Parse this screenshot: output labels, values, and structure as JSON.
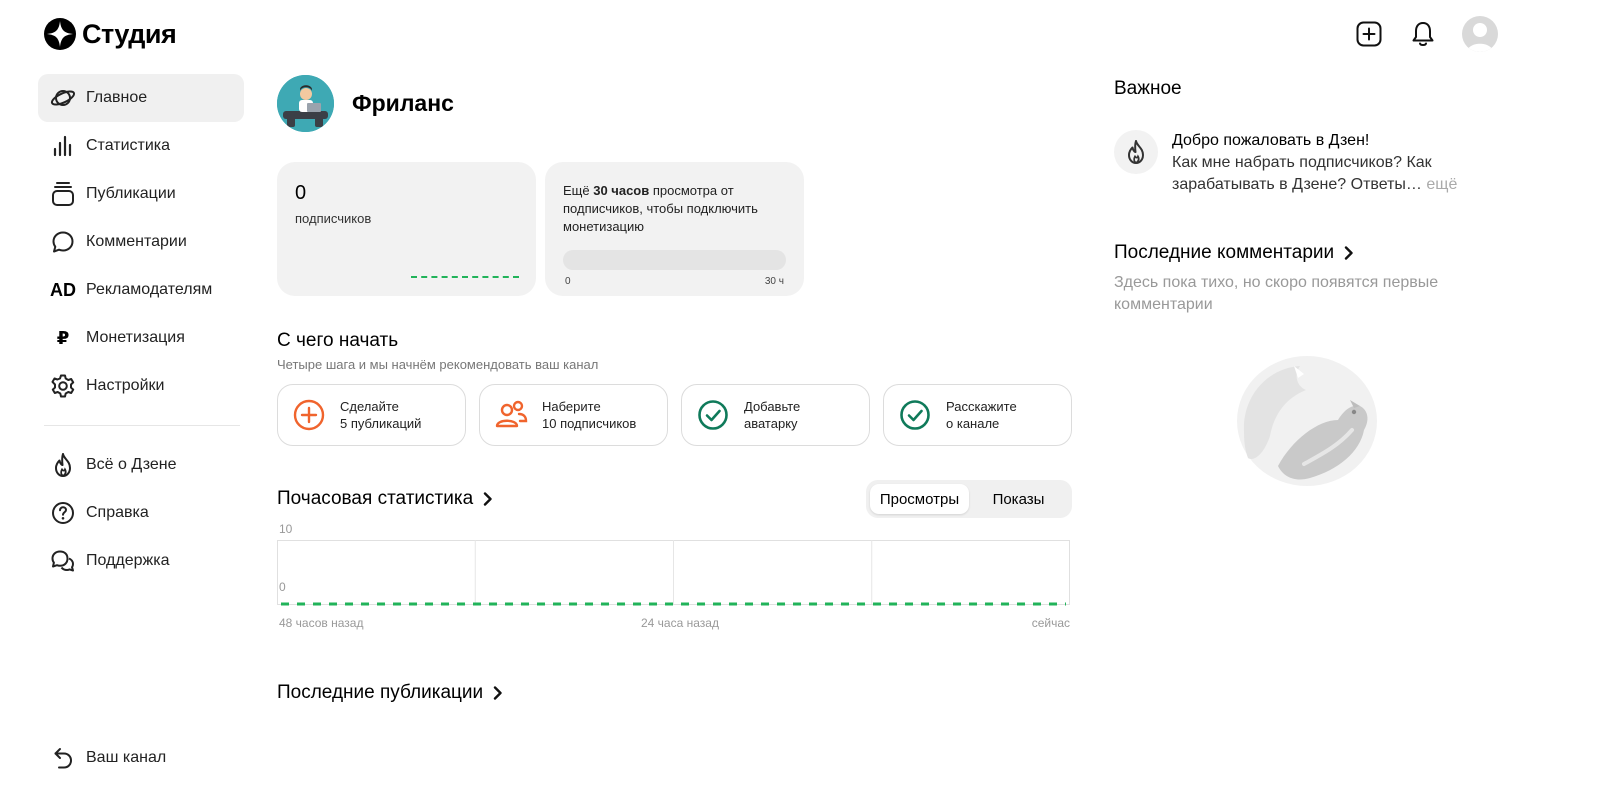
{
  "app": {
    "logo_text": "Студия"
  },
  "top_actions": {
    "create_icon": "plus-square-icon",
    "bell_icon": "bell-icon",
    "avatar_icon": "user-avatar"
  },
  "sidebar": {
    "items": [
      {
        "label": "Главное",
        "icon": "planet-icon",
        "active": true
      },
      {
        "label": "Статистика",
        "icon": "bar-chart-icon"
      },
      {
        "label": "Публикации",
        "icon": "stack-icon"
      },
      {
        "label": "Комментарии",
        "icon": "speech-bubble-icon"
      },
      {
        "label": "Рекламодателям",
        "icon": "ad-icon",
        "icon_text": "AD"
      },
      {
        "label": "Монетизация",
        "icon": "ruble-icon",
        "icon_text": "₽"
      },
      {
        "label": "Настройки",
        "icon": "gear-icon"
      }
    ],
    "secondary": [
      {
        "label": "Всё о Дзене",
        "icon": "flame-icon"
      },
      {
        "label": "Справка",
        "icon": "question-icon"
      },
      {
        "label": "Поддержка",
        "icon": "chat-bubbles-icon"
      }
    ],
    "bottom": {
      "label": "Ваш канал",
      "icon": "back-arrow-icon"
    }
  },
  "channel": {
    "name": "Фриланс"
  },
  "subscribers_card": {
    "value": "0",
    "label": "подписчиков"
  },
  "monetization_card": {
    "text_prefix": "Ещё ",
    "text_bold": "30 часов",
    "text_suffix": " просмотра от подписчиков, чтобы подключить монетизацию",
    "progress": 0,
    "min_label": "0",
    "max_label": "30 ч"
  },
  "getting_started": {
    "title": "С чего начать",
    "subtitle": "Четыре шага и мы начнём рекомендовать ваш канал",
    "steps": [
      {
        "line1": "Сделайте",
        "line2": "5 публикаций",
        "icon": "plus-circle-icon",
        "done": false
      },
      {
        "line1": "Наберите",
        "line2": "10 подписчиков",
        "icon": "people-icon",
        "done": false
      },
      {
        "line1": "Добавьте",
        "line2": "аватарку",
        "icon": "check-circle-icon",
        "done": true
      },
      {
        "line1": "Расскажите",
        "line2": "о канале",
        "icon": "check-circle-icon",
        "done": true
      }
    ]
  },
  "hourly": {
    "title": "Почасовая статистика",
    "tabs": [
      {
        "label": "Просмотры",
        "active": true
      },
      {
        "label": "Показы",
        "active": false
      }
    ],
    "y_max_label": "10",
    "y_min_label": "0",
    "x_labels": [
      "48 часов назад",
      "24 часа назад",
      "сейчас"
    ]
  },
  "chart_data": {
    "type": "line",
    "x_labels": [
      "48 часов назад",
      "24 часа назад",
      "сейчас"
    ],
    "ylim": [
      0,
      10
    ],
    "series": [
      {
        "values": [
          0,
          0,
          0,
          0,
          0,
          0,
          0,
          0,
          0,
          0,
          0,
          0,
          0,
          0,
          0,
          0,
          0,
          0,
          0,
          0,
          0,
          0,
          0,
          0,
          0,
          0,
          0,
          0,
          0,
          0,
          0,
          0,
          0,
          0,
          0,
          0,
          0,
          0,
          0,
          0,
          0,
          0,
          0,
          0,
          0,
          0,
          0,
          0
        ]
      }
    ]
  },
  "latest_publications": {
    "title": "Последние публикации"
  },
  "right_panel": {
    "important_title": "Важное",
    "notice_title": "Добро пожаловать в Дзен!",
    "notice_body": "Как мне набрать подписчиков? Как зарабатывать в Дзене? Ответы…",
    "notice_more": "ещё",
    "comments_title": "Последние комментарии",
    "comments_empty": "Здесь пока тихо, но скоро появятся первые комментарии"
  },
  "colors": {
    "accent_green": "#21b35a",
    "accent_orange": "#f0642d",
    "teal_check": "#0f7a5a"
  }
}
